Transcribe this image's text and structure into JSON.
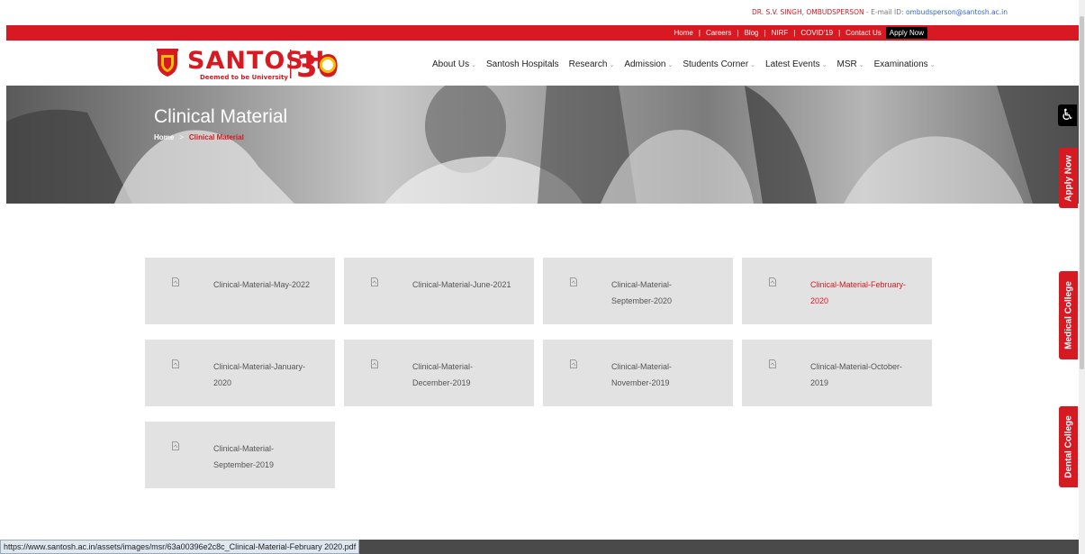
{
  "top_info": {
    "name": "DR. S.V. SINGH, OMBUDSPERSON",
    "email_prefix": " - E-mail ID: ",
    "email": "ombudsperson@santosh.ac.in"
  },
  "top_links": [
    "Home",
    "Careers",
    "Blog",
    "NIRF",
    "COVID'19",
    "Contact Us"
  ],
  "apply_now": "Apply Now",
  "brand": {
    "name": "SANTOSH",
    "tagline": "Deemed to be University",
    "anniversary": "30"
  },
  "main_nav": [
    {
      "label": "About Us",
      "caret": true
    },
    {
      "label": "Santosh Hospitals",
      "caret": false
    },
    {
      "label": "Research",
      "caret": true
    },
    {
      "label": "Admission",
      "caret": true
    },
    {
      "label": "Students Corner",
      "caret": true
    },
    {
      "label": "Latest Events",
      "caret": true
    },
    {
      "label": "MSR",
      "caret": true
    },
    {
      "label": "Examinations",
      "caret": true
    }
  ],
  "hero": {
    "title": "Clinical Material",
    "breadcrumb_home": "Home",
    "breadcrumb_sep": ">",
    "breadcrumb_current": "Clinical Material"
  },
  "documents": [
    {
      "label": "Clinical-Material-May-2022",
      "active": false
    },
    {
      "label": "Clinical-Material-June-2021",
      "active": false
    },
    {
      "label": "Clinical-Material-September-2020",
      "active": false
    },
    {
      "label": "Clinical-Material-February-2020",
      "active": true
    },
    {
      "label": "Clinical-Material-January-2020",
      "active": false
    },
    {
      "label": "Clinical-Material-December-2019",
      "active": false
    },
    {
      "label": "Clinical-Material-November-2019",
      "active": false
    },
    {
      "label": "Clinical-Material-October-2019",
      "active": false
    },
    {
      "label": "Clinical-Material-September-2019",
      "active": false
    }
  ],
  "side_tabs": {
    "apply": "Apply Now",
    "medical": "Medical College",
    "dental": "Dental College",
    "accessibility_icon": "accessibility-icon"
  },
  "status_url": "https://www.santosh.ac.in/assets/images/msr/63a00396e2c8c_Clinical-Material-February 2020.pdf",
  "colors": {
    "brand_red": "#d71921",
    "card_bg": "#e2e2e2"
  }
}
